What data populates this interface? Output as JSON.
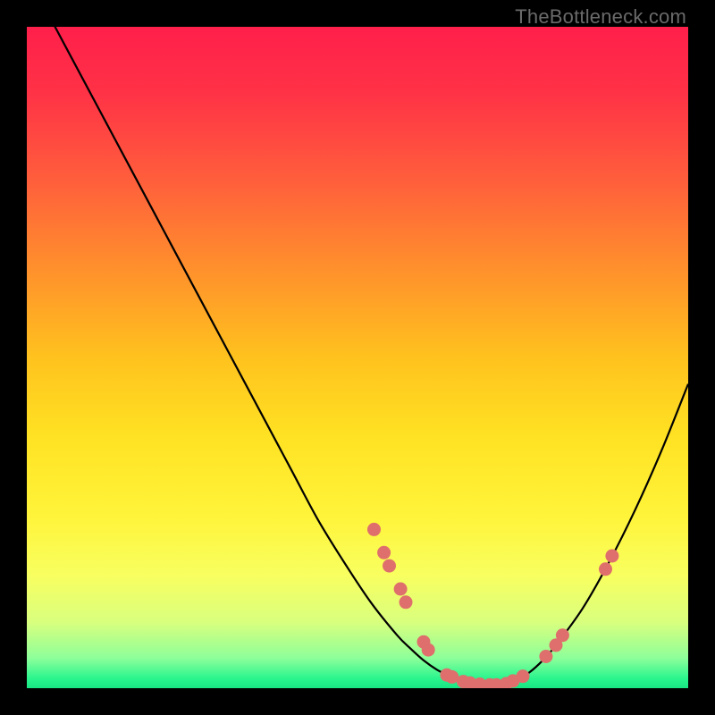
{
  "watermark": "TheBottleneck.com",
  "gradient": {
    "stops": [
      {
        "offset": 0.0,
        "color": "#ff1f4b"
      },
      {
        "offset": 0.1,
        "color": "#ff3246"
      },
      {
        "offset": 0.22,
        "color": "#ff5a3d"
      },
      {
        "offset": 0.35,
        "color": "#ff8a2e"
      },
      {
        "offset": 0.5,
        "color": "#ffc21e"
      },
      {
        "offset": 0.62,
        "color": "#ffe223"
      },
      {
        "offset": 0.74,
        "color": "#fff43a"
      },
      {
        "offset": 0.83,
        "color": "#f8ff60"
      },
      {
        "offset": 0.9,
        "color": "#d9ff7e"
      },
      {
        "offset": 0.955,
        "color": "#8cff9a"
      },
      {
        "offset": 0.985,
        "color": "#2bf58e"
      },
      {
        "offset": 1.0,
        "color": "#17e683"
      }
    ]
  },
  "curve_color": "#000000",
  "point_color": "#df6f6c",
  "chart_data": {
    "type": "line",
    "title": "",
    "xlabel": "",
    "ylabel": "",
    "xlim": [
      0,
      100
    ],
    "ylim": [
      0,
      100
    ],
    "series": [
      {
        "name": "bottleneck-curve",
        "x": [
          0,
          4,
          8,
          12,
          16,
          20,
          24,
          28,
          32,
          36,
          40,
          44,
          48,
          52,
          56,
          58,
          60,
          62,
          64,
          66,
          68,
          70,
          72,
          74,
          76,
          78,
          80,
          84,
          88,
          92,
          96,
          100
        ],
        "y": [
          108,
          100.5,
          93,
          85.5,
          78,
          70.5,
          63,
          55.5,
          48,
          40.5,
          33,
          25.5,
          19,
          13,
          8,
          6,
          4.2,
          2.8,
          1.8,
          1.0,
          0.6,
          0.5,
          0.6,
          1.2,
          2.4,
          4.2,
          6.5,
          12,
          19,
          27,
          36,
          46
        ]
      }
    ],
    "scatter": [
      {
        "name": "marker",
        "x": 52.5,
        "y": 24.0
      },
      {
        "name": "marker",
        "x": 54.0,
        "y": 20.5
      },
      {
        "name": "marker",
        "x": 54.8,
        "y": 18.5
      },
      {
        "name": "marker",
        "x": 56.5,
        "y": 15.0
      },
      {
        "name": "marker",
        "x": 57.3,
        "y": 13.0
      },
      {
        "name": "marker",
        "x": 60.0,
        "y": 7.0
      },
      {
        "name": "marker",
        "x": 60.7,
        "y": 5.8
      },
      {
        "name": "marker",
        "x": 63.5,
        "y": 2.0
      },
      {
        "name": "marker",
        "x": 64.3,
        "y": 1.7
      },
      {
        "name": "marker",
        "x": 66.0,
        "y": 1.0
      },
      {
        "name": "marker",
        "x": 67.0,
        "y": 0.8
      },
      {
        "name": "marker",
        "x": 68.5,
        "y": 0.6
      },
      {
        "name": "marker",
        "x": 70.0,
        "y": 0.5
      },
      {
        "name": "marker",
        "x": 71.0,
        "y": 0.5
      },
      {
        "name": "marker",
        "x": 72.5,
        "y": 0.7
      },
      {
        "name": "marker",
        "x": 73.5,
        "y": 1.1
      },
      {
        "name": "marker",
        "x": 75.0,
        "y": 1.8
      },
      {
        "name": "marker",
        "x": 78.5,
        "y": 4.8
      },
      {
        "name": "marker",
        "x": 80.0,
        "y": 6.5
      },
      {
        "name": "marker",
        "x": 81.0,
        "y": 8.0
      },
      {
        "name": "marker",
        "x": 87.5,
        "y": 18.0
      },
      {
        "name": "marker",
        "x": 88.5,
        "y": 20.0
      }
    ]
  }
}
